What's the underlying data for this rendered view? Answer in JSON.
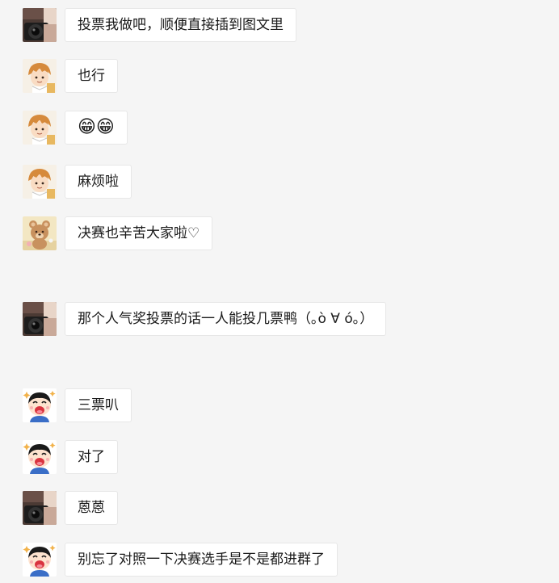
{
  "chat": {
    "messages": [
      {
        "sender": "camera-user",
        "text": "投票我做吧，顺便直接插到图文里"
      },
      {
        "sender": "cartoon-boy",
        "text": "也行"
      },
      {
        "sender": "cartoon-boy",
        "text": "😁😁"
      },
      {
        "sender": "cartoon-boy",
        "text": "麻烦啦"
      },
      {
        "sender": "teddy-bear",
        "text": "决赛也辛苦大家啦♡"
      },
      {
        "sender": "camera-user",
        "text": "那个人气奖投票的话一人能投几票鸭（｡ò ∀ ó｡）"
      },
      {
        "sender": "laughing-kid",
        "text": "三票叭"
      },
      {
        "sender": "laughing-kid",
        "text": "对了"
      },
      {
        "sender": "camera-user",
        "text": "蒽蒽"
      },
      {
        "sender": "laughing-kid",
        "text": "别忘了对照一下决赛选手是不是都进群了"
      }
    ]
  },
  "colors": {
    "background": "#f5f5f5",
    "bubble": "#ffffff",
    "bubble_border": "#e7e7e7",
    "text": "#1a1a1a"
  }
}
